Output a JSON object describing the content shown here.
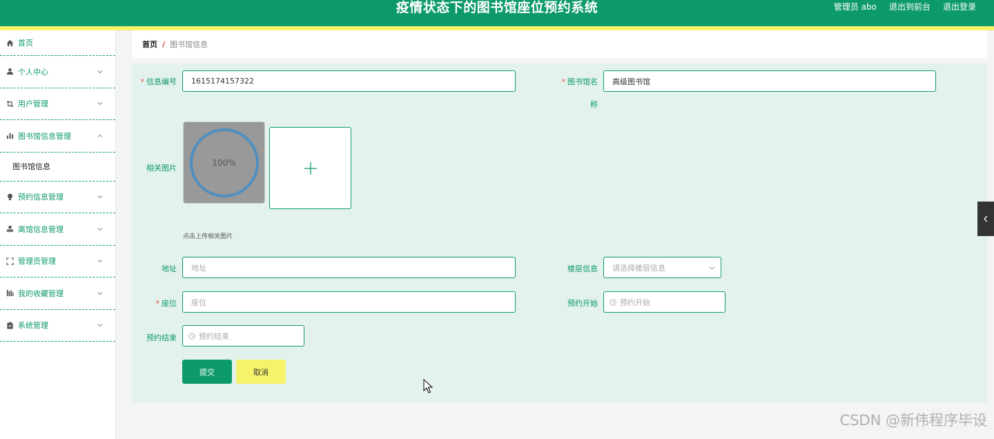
{
  "header": {
    "title": "疫情状态下的图书馆座位预约系统",
    "user": "管理员 abo",
    "front_link": "退出到前台",
    "logout_link": "退出登录"
  },
  "sidebar": {
    "items": [
      {
        "label": "首页",
        "icon": "home-icon"
      },
      {
        "label": "个人中心",
        "icon": "user-icon"
      },
      {
        "label": "用户管理",
        "icon": "crop-icon"
      },
      {
        "label": "图书馆信息管理",
        "icon": "bar-chart-icon"
      },
      {
        "label": "图书馆信息",
        "icon": ""
      },
      {
        "label": "预约信息管理",
        "icon": "bulb-icon"
      },
      {
        "label": "离馆信息管理",
        "icon": "stamp-icon"
      },
      {
        "label": "管理员管理",
        "icon": "fullscreen-icon"
      },
      {
        "label": "我的收藏管理",
        "icon": "chart-icon"
      },
      {
        "label": "系统管理",
        "icon": "clipboard-icon"
      }
    ]
  },
  "breadcrumb": {
    "home": "首页",
    "separator": "/",
    "current": "图书馆信息"
  },
  "form": {
    "info_no_label": "信息编号",
    "info_no_value": "1615174157322",
    "lib_name_label_1": "图书馆名",
    "lib_name_label_2": "称",
    "lib_name_value": "高级图书馆",
    "image_label": "相关图片",
    "upload_progress": "100%",
    "upload_tip": "点击上传相关图片",
    "address_label": "地址",
    "address_placeholder": "地址",
    "floor_label": "楼层信息",
    "floor_placeholder": "请选择楼层信息",
    "seat_label": "座位",
    "seat_placeholder": "座位",
    "start_label": "预约开始",
    "start_placeholder": "预约开始",
    "end_label": "预约结束",
    "end_placeholder": "预约结束",
    "submit_label": "提交",
    "cancel_label": "取消"
  },
  "watermark": "CSDN @新伟程序毕设",
  "colors": {
    "primary": "#0d9a69",
    "accent_yellow": "#f5f36a",
    "panel_bg": "#e3f2ec",
    "required": "#e54d42"
  }
}
